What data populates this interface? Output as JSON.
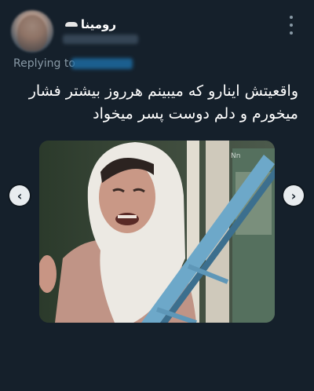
{
  "user": {
    "display_name": "رومینا",
    "avatar_icon": "avatar-icon"
  },
  "reply": {
    "label": "Replying to"
  },
  "tweet": {
    "text": "واقعیتش اینارو که میبینم هرروز بیشتر فشار میخورم و دلم دوست پسر میخواد"
  },
  "media": {
    "prev_icon": "‹",
    "next_icon": "›"
  },
  "colors": {
    "background": "#15202b",
    "secondary_text": "#8899a6",
    "accent": "#1d9bf0"
  }
}
